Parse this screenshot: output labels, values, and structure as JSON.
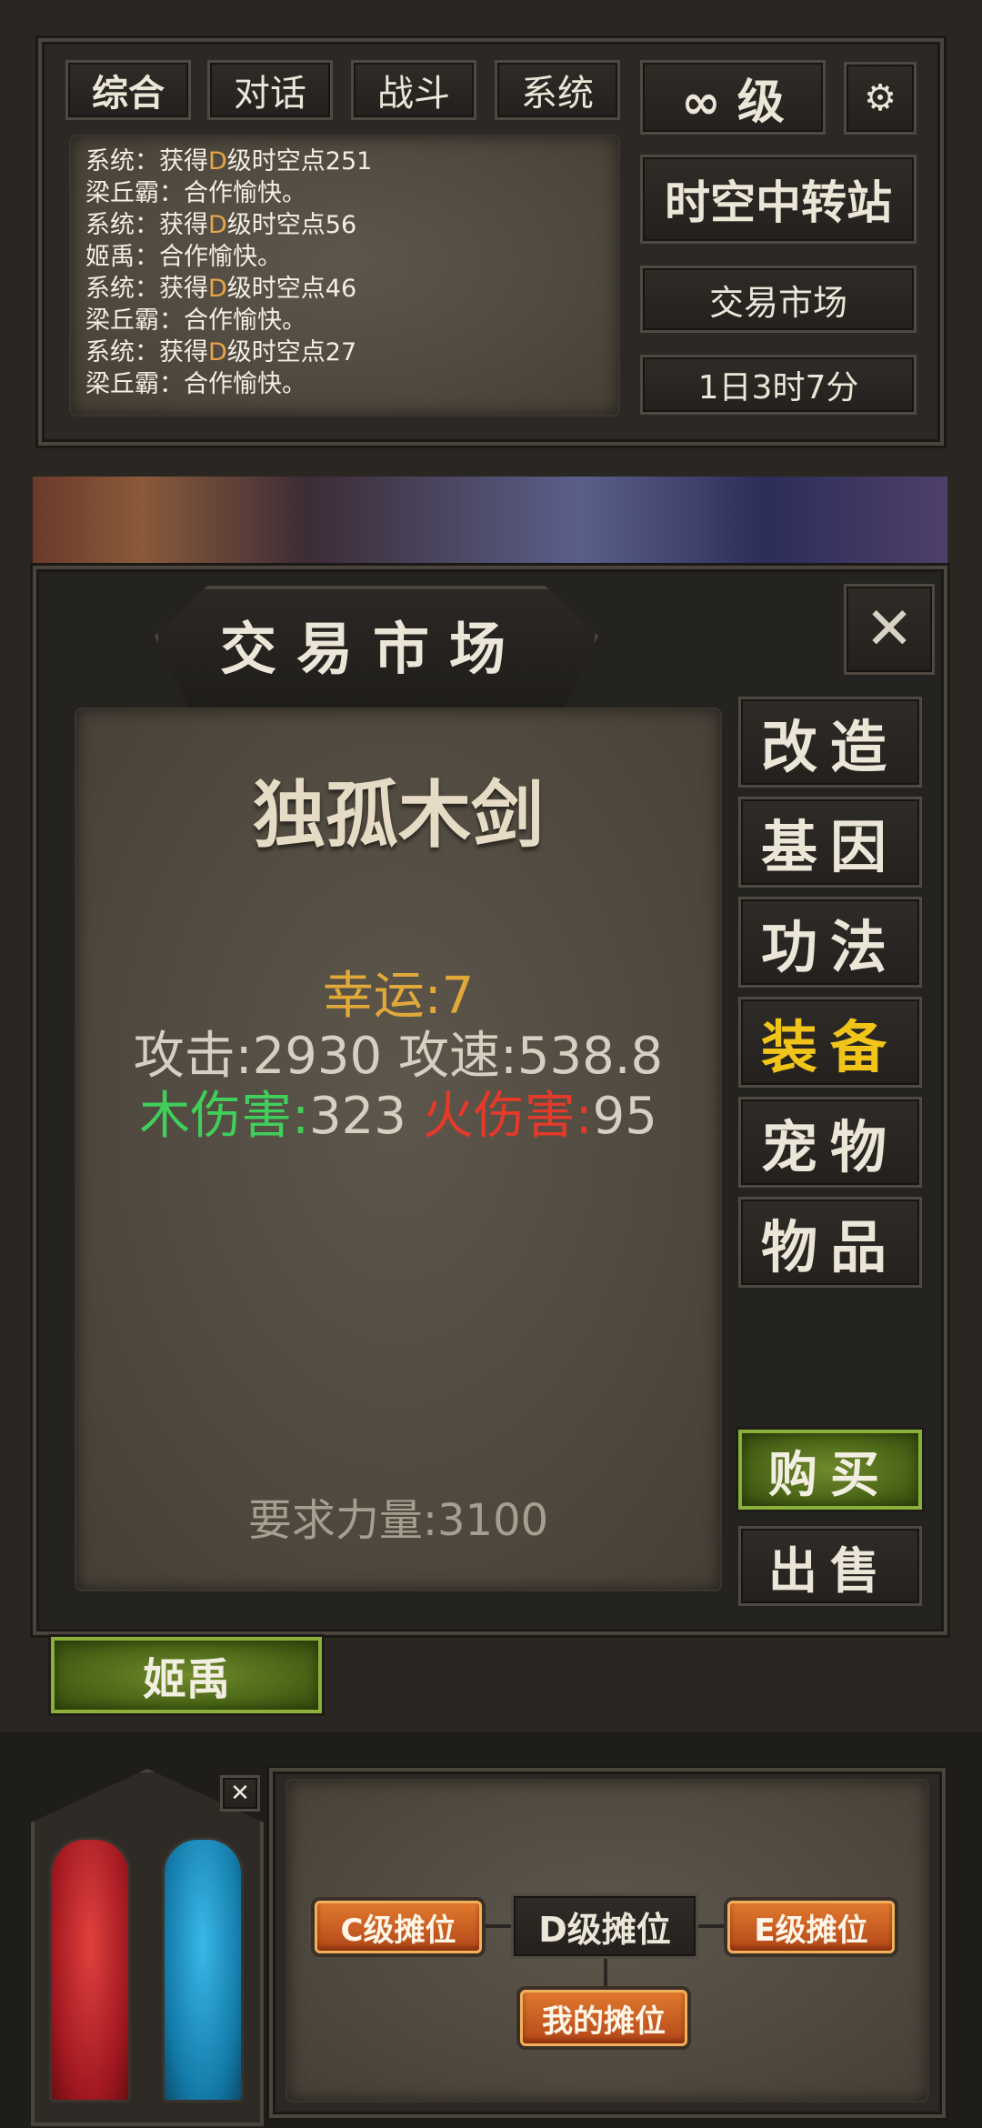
{
  "chat": {
    "tabs": [
      "综合",
      "对话",
      "战斗",
      "系统"
    ],
    "level_label": "∞ 级",
    "lines": [
      {
        "speaker": "系统",
        "pre": "获得",
        "grade": "D",
        "post": "级时空点251"
      },
      {
        "speaker": "梁丘霸",
        "pre": "合作愉快。",
        "grade": "",
        "post": ""
      },
      {
        "speaker": "系统",
        "pre": "获得",
        "grade": "D",
        "post": "级时空点56"
      },
      {
        "speaker": "姬禹",
        "pre": "合作愉快。",
        "grade": "",
        "post": ""
      },
      {
        "speaker": "系统",
        "pre": "获得",
        "grade": "D",
        "post": "级时空点46"
      },
      {
        "speaker": "梁丘霸",
        "pre": "合作愉快。",
        "grade": "",
        "post": ""
      },
      {
        "speaker": "系统",
        "pre": "获得",
        "grade": "D",
        "post": "级时空点27"
      },
      {
        "speaker": "梁丘霸",
        "pre": "合作愉快。",
        "grade": "",
        "post": ""
      }
    ],
    "separator": "："
  },
  "location": {
    "station": "时空中转站",
    "market": "交易市场",
    "timer": "1日3时7分"
  },
  "background_npc": {
    "name": "姬禹"
  },
  "dialog": {
    "title": "交易市场",
    "item": {
      "name": "独孤木剑",
      "luck": "幸运:7",
      "attack_label": "攻击:2930",
      "speed_label": "攻速:538.8",
      "wood_label": "木伤害:",
      "wood_value": "323",
      "fire_label": "火伤害:",
      "fire_value": "95",
      "requirement": "要求力量:3100"
    },
    "categories": [
      "改造",
      "基因",
      "功法",
      "装备",
      "宠物",
      "物品"
    ],
    "active_category": "装备",
    "buy_label": "购买",
    "sell_label": "出售"
  },
  "bottom": {
    "stall_c": "C级摊位",
    "stall_d": "D级摊位",
    "stall_e": "E级摊位",
    "my_stall": "我的摊位"
  },
  "colors": {
    "luck": "#e0a93a",
    "active_category": "#f0c419",
    "wood": "#3fcf5a",
    "fire": "#e33a2a",
    "hp_orb": "#c3212a",
    "mp_orb": "#1e8bc0"
  },
  "icons": [
    "gear-icon",
    "close-icon",
    "small-close-icon",
    "hp-orb-icon",
    "mp-orb-icon"
  ]
}
